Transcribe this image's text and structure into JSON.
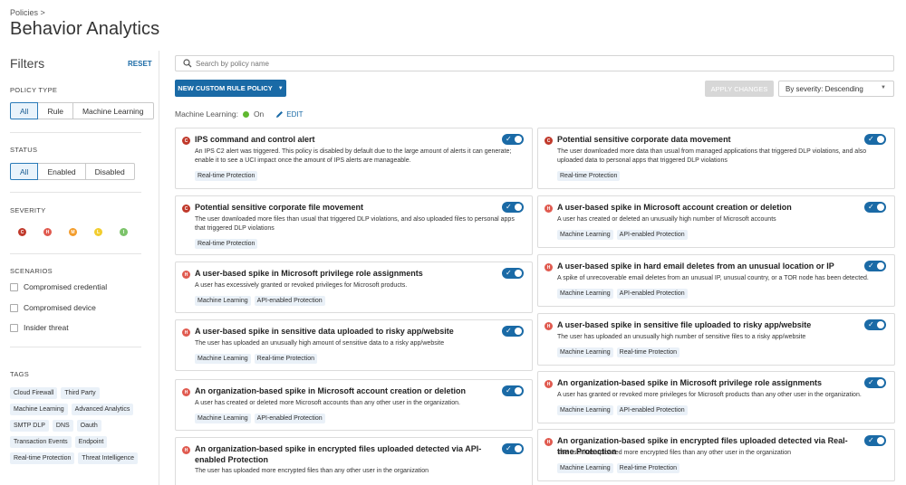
{
  "breadcrumb": "Policies >",
  "title": "Behavior Analytics",
  "sidebar": {
    "filters_label": "Filters",
    "reset_label": "RESET",
    "policy_type": {
      "label": "POLICY TYPE",
      "options": [
        "All",
        "Rule",
        "Machine Learning"
      ],
      "selected": "All"
    },
    "status": {
      "label": "STATUS",
      "options": [
        "All",
        "Enabled",
        "Disabled"
      ],
      "selected": "All"
    },
    "severity": {
      "label": "SEVERITY",
      "levels": [
        {
          "code": "C",
          "color": "#c0392b"
        },
        {
          "code": "H",
          "color": "#e05a4f"
        },
        {
          "code": "M",
          "color": "#f39c2a"
        },
        {
          "code": "L",
          "color": "#f2cd2e"
        },
        {
          "code": "I",
          "color": "#7cc36a"
        }
      ]
    },
    "scenarios": {
      "label": "SCENARIOS",
      "items": [
        "Compromised credential",
        "Compromised device",
        "Insider threat"
      ]
    },
    "tags": {
      "label": "TAGS",
      "items": [
        "Cloud Firewall",
        "Third Party",
        "Machine Learning",
        "Advanced Analytics",
        "SMTP DLP",
        "DNS",
        "Oauth",
        "Transaction Events",
        "Endpoint",
        "Real-time Protection",
        "Threat Intelligence"
      ]
    }
  },
  "search": {
    "placeholder": "Search by policy name"
  },
  "toolbar": {
    "new_rule_label": "NEW CUSTOM RULE POLICY",
    "apply_label": "APPLY CHANGES",
    "sort_label": "By severity: Descending"
  },
  "ml_status": {
    "label": "Machine Learning:",
    "state": "On",
    "edit_label": "EDIT"
  },
  "colors": {
    "accent": "#1a6aa6",
    "critical": "#c0392b",
    "high": "#e05a4f"
  },
  "policies_left": [
    {
      "sev": "C",
      "title": "IPS command and control alert",
      "desc": "An IPS C2 alert was triggered. This policy is disabled by default due to the large amount of alerts it can generate; enable it to see a UCI impact once the amount of IPS alerts are manageable.",
      "tags": [
        "Real-time Protection"
      ]
    },
    {
      "sev": "C",
      "title": "Potential sensitive corporate file movement",
      "desc": "The user downloaded more files than usual that triggered DLP violations, and also uploaded files to personal apps that triggered DLP violations",
      "tags": [
        "Real-time Protection"
      ]
    },
    {
      "sev": "H",
      "title": "A user-based spike in Microsoft privilege role assignments",
      "desc": "A user has excessively granted or revoked privileges for Microsoft products.",
      "tags": [
        "Machine Learning",
        "API-enabled Protection"
      ]
    },
    {
      "sev": "H",
      "title": "A user-based spike in sensitive data uploaded to risky app/website",
      "desc": "The user has uploaded an unusually high amount of sensitive data to a risky app/website",
      "tags": [
        "Machine Learning",
        "Real-time Protection"
      ]
    },
    {
      "sev": "H",
      "title": "An organization-based spike in Microsoft account creation or deletion",
      "desc": "A user has created or deleted more Microsoft accounts than any other user in the organization.",
      "tags": [
        "Machine Learning",
        "API-enabled Protection"
      ]
    },
    {
      "sev": "H",
      "title": "An organization-based spike in encrypted files uploaded detected via API-enabled Protection",
      "desc": "The user has uploaded more encrypted files than any other user in the organization",
      "tags": []
    }
  ],
  "policies_right": [
    {
      "sev": "C",
      "title": "Potential sensitive corporate data movement",
      "desc": "The user downloaded more data than usual from managed applications that triggered DLP violations, and also uploaded data to personal apps that triggered DLP violations",
      "tags": [
        "Real-time Protection"
      ]
    },
    {
      "sev": "H",
      "title": "A user-based spike in Microsoft account creation or deletion",
      "desc": "A user has created or deleted an unusually high number of Microsoft accounts",
      "tags": [
        "Machine Learning",
        "API-enabled Protection"
      ]
    },
    {
      "sev": "H",
      "title": "A user-based spike in hard email deletes from an unusual location or IP",
      "desc": "A spike of unrecoverable email deletes from an unusual IP, unusual country, or a TOR node has been detected.",
      "tags": [
        "Machine Learning",
        "API-enabled Protection"
      ]
    },
    {
      "sev": "H",
      "title": "A user-based spike in sensitive file uploaded to risky app/website",
      "desc": "The user has uploaded an unusually high number of sensitive files to a risky app/website",
      "tags": [
        "Machine Learning",
        "Real-time Protection"
      ]
    },
    {
      "sev": "H",
      "title": "An organization-based spike in Microsoft privilege role assignments",
      "desc": "A user has granted or revoked more privileges for Microsoft products than any other user in the organization.",
      "tags": [
        "Machine Learning",
        "API-enabled Protection"
      ]
    },
    {
      "sev": "H",
      "title": "An organization-based spike in encrypted files uploaded detected via Real-time Protection",
      "desc": "The user has uploaded more encrypted files than any other user in the organization",
      "tags": [
        "Machine Learning",
        "Real-time Protection"
      ]
    }
  ]
}
